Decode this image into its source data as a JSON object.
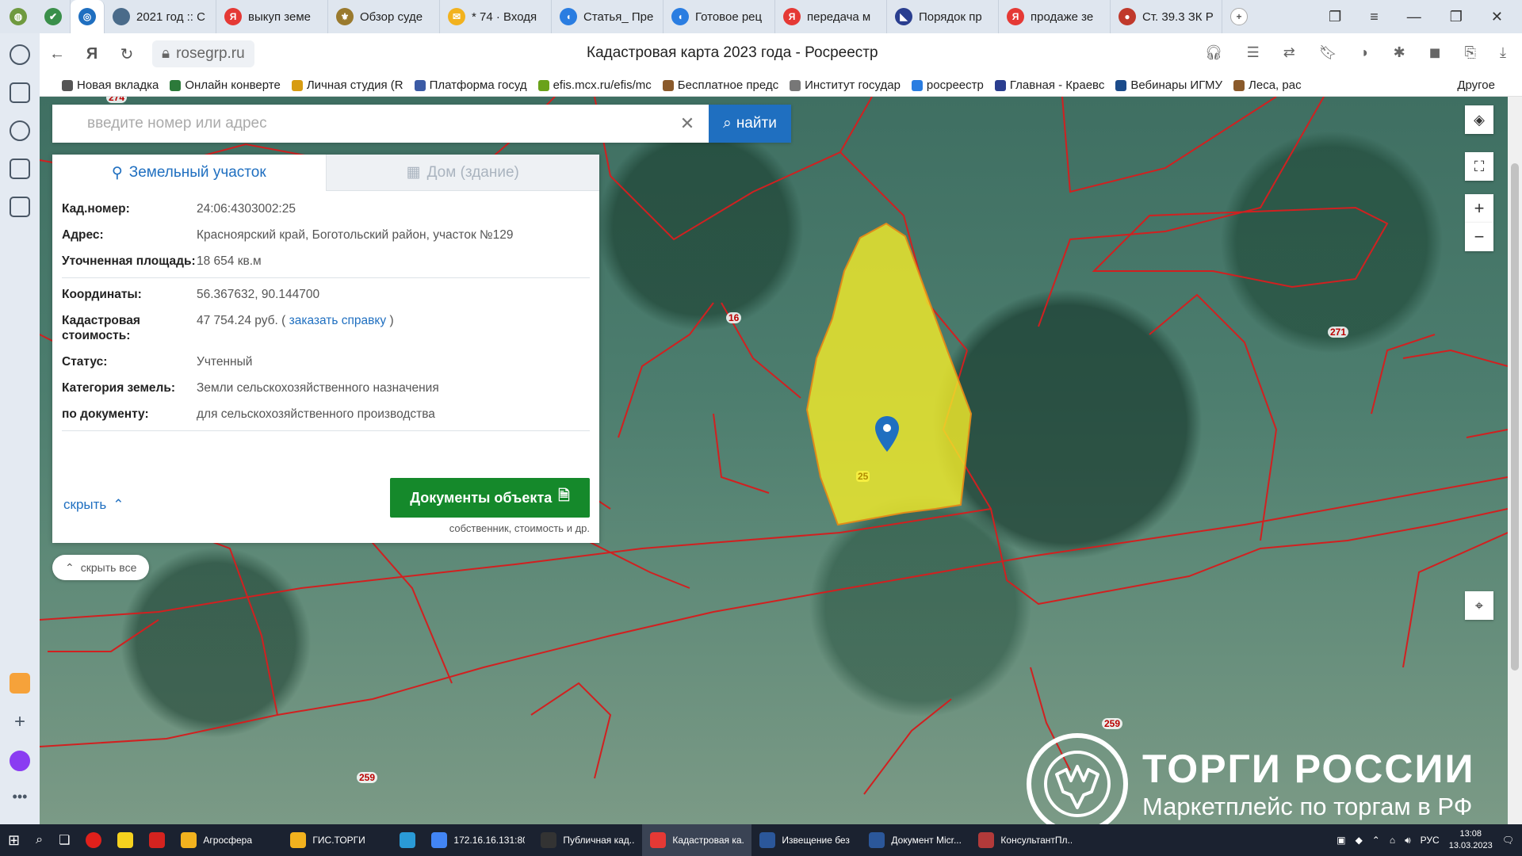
{
  "browser": {
    "tabs": [
      {
        "label": "",
        "color": "#3a8f4a",
        "glyph": "✔"
      },
      {
        "label": "",
        "color": "#1f6fc0",
        "glyph": "◎",
        "active": true
      },
      {
        "label": "2021 год :: С",
        "color": "#4a6b8a",
        "glyph": ""
      },
      {
        "label": "выкуп земе",
        "color": "#e53935",
        "glyph": "Я"
      },
      {
        "label": "Обзор суде",
        "color": "#9a7a2e",
        "glyph": "⚜"
      },
      {
        "label": "* 74 · Входя",
        "color": "#f2b21e",
        "glyph": "✉"
      },
      {
        "label": "Статья_ Пре",
        "color": "#2a7de1",
        "glyph": "◖"
      },
      {
        "label": "Готовое рец",
        "color": "#2a7de1",
        "glyph": "◖"
      },
      {
        "label": "передача м",
        "color": "#e53935",
        "glyph": "Я"
      },
      {
        "label": "Порядок пр",
        "color": "#2a3e8f",
        "glyph": "◣"
      },
      {
        "label": "продаже зе",
        "color": "#e53935",
        "glyph": "Я"
      },
      {
        "label": "Ст. 39.3 ЗК Р",
        "color": "#c0392b",
        "glyph": "●"
      }
    ],
    "new_tab": "+",
    "url": "rosegrp.ru",
    "page_title": "Кадастровая карта 2023 года - Росреестр",
    "bookmarks": [
      {
        "label": "Новая вкладка",
        "color": "#555"
      },
      {
        "label": "Онлайн конверте",
        "color": "#2c7a3a"
      },
      {
        "label": "Личная студия (R",
        "color": "#d79c12"
      },
      {
        "label": "Платформа госуд",
        "color": "#3b5ba5"
      },
      {
        "label": "efis.mcx.ru/efis/mc",
        "color": "#6aa21a"
      },
      {
        "label": "Бесплатное предс",
        "color": "#8a5a2b"
      },
      {
        "label": "Институт государ",
        "color": "#777"
      },
      {
        "label": "росреестр",
        "color": "#2a7de1"
      },
      {
        "label": "Главная - Краевс",
        "color": "#2a3e8f"
      },
      {
        "label": "Вебинары ИГМУ",
        "color": "#1b4b8a"
      },
      {
        "label": "Леса, рас",
        "color": "#8a5a2b"
      }
    ],
    "bookmarks_other": "Другое"
  },
  "search": {
    "placeholder": "введите номер или адрес",
    "value": "",
    "button": "найти"
  },
  "panel": {
    "tab_land": "Земельный участок",
    "tab_building": "Дом (здание)",
    "rows": [
      {
        "key": "Кад.номер:",
        "value": "24:06:4303002:25"
      },
      {
        "key": "Адрес:",
        "value": "Красноярский край, Боготольский район, участок №129"
      },
      {
        "key": "Уточненная площадь:",
        "value": "18 654 кв.м"
      }
    ],
    "rows2": [
      {
        "key": "Координаты:",
        "value": "56.367632, 90.144700"
      }
    ],
    "cost_key": "Кадастровая стоимость:",
    "cost_value": "47 754.24 руб.",
    "cost_open": "(",
    "cost_link": "заказать справку",
    "cost_close": ")",
    "rows3": [
      {
        "key": "Статус:",
        "value": "Учтенный"
      },
      {
        "key": "Категория земель:",
        "value": "Земли сельскохозяйственного назначения"
      },
      {
        "key": "по документу:",
        "value": "для сельскохозяйственного производства"
      }
    ],
    "hide": "скрыть",
    "docs_button": "Документы объекта",
    "docs_sub": "собственник, стоимость и др."
  },
  "hide_all": "скрыть все",
  "map": {
    "labels": [
      "274",
      "16",
      "271",
      "259",
      "259"
    ],
    "parcel_number": "25",
    "zoom_in": "+",
    "zoom_out": "−",
    "parcel_fill": "#f2ea2a",
    "boundary_color": "#d12020"
  },
  "watermark": {
    "title": "ТОРГИ РОССИИ",
    "subtitle": "Маркетплейс по торгам в РФ"
  },
  "taskbar": {
    "items": [
      {
        "label": "Агросфера",
        "color": "#f2b21e"
      },
      {
        "label": "ГИС.ТОРГИ",
        "color": "#f2b21e"
      },
      {
        "label": "",
        "color": "#2a9ad6"
      },
      {
        "label": "172.16.16.131:80...",
        "color": "#4285f4"
      },
      {
        "label": "Публичная кад...",
        "color": "#333"
      },
      {
        "label": "Кадастровая ка...",
        "color": "#e53935",
        "active": true
      },
      {
        "label": "Извещение без ...",
        "color": "#2b579a"
      },
      {
        "label": "Документ Micr...",
        "color": "#2b579a"
      },
      {
        "label": "КонсультантПл...",
        "color": "#b23a3a"
      }
    ],
    "lang": "РУС",
    "time": "13:08",
    "date": "13.03.2023"
  }
}
